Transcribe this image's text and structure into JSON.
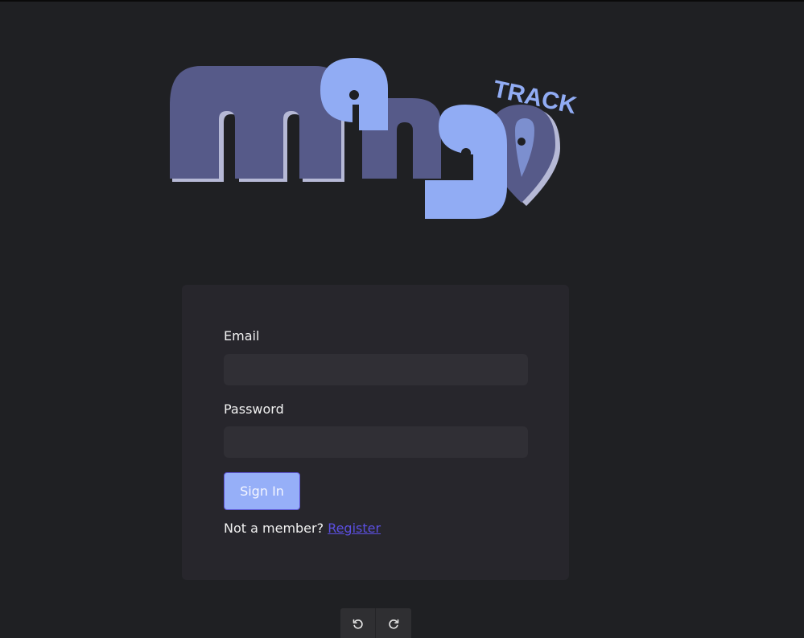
{
  "logo": {
    "word": "mango",
    "tagline": "TRACK",
    "colors": {
      "dark": "#565a89",
      "light": "#91acf4",
      "shadow": "#b6b9d6"
    }
  },
  "login": {
    "email_label": "Email",
    "email_value": "",
    "password_label": "Password",
    "password_value": "",
    "signin_label": "Sign In",
    "register_prompt": "Not a member?",
    "register_link": "Register"
  },
  "toolbar": {
    "undo_icon": "rotate-ccw-icon",
    "redo_icon": "rotate-cw-icon"
  },
  "colors": {
    "background": "#1f2023",
    "card": "#27262c",
    "input": "#302f35",
    "button": "#96aff8",
    "link": "#5b4fe0"
  }
}
